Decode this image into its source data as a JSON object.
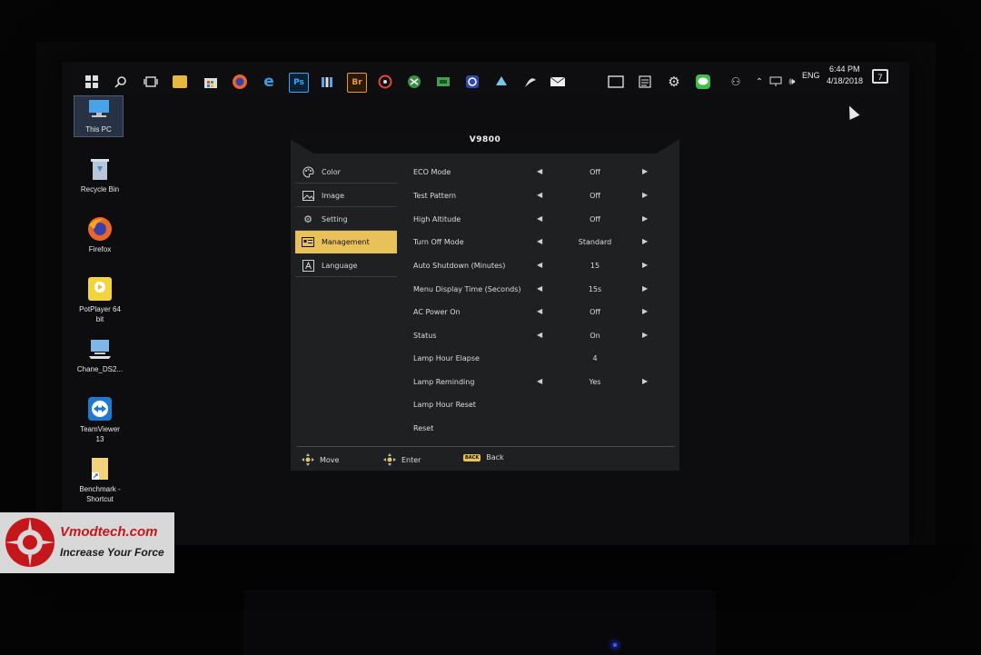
{
  "taskbar": {
    "icons": [
      "windows-start-icon",
      "search-icon",
      "task-view-icon",
      "file-explorer-icon",
      "store-icon",
      "firefox-icon",
      "edge-icon",
      "photoshop-icon",
      "app-icon",
      "bridge-icon",
      "app-icon",
      "app-icon",
      "app-icon",
      "app-icon",
      "app-icon",
      "app-icon",
      "mail-icon",
      "window-icon",
      "app-icon",
      "gear-icon",
      "line-icon"
    ],
    "ps_label": "Ps",
    "br_label": "Br",
    "language": "ENG",
    "time": "6:44 PM",
    "date": "4/18/2018",
    "notifications": "7"
  },
  "desktop": {
    "icons": [
      {
        "label1": "This PC",
        "label2": ""
      },
      {
        "label1": "Recycle Bin",
        "label2": ""
      },
      {
        "label1": "Firefox",
        "label2": ""
      },
      {
        "label1": "PotPlayer 64",
        "label2": "bit"
      },
      {
        "label1": "Chane_DS2...",
        "label2": ""
      },
      {
        "label1": "TeamViewer",
        "label2": "13"
      },
      {
        "label1": "Benchmark -",
        "label2": "Shortcut"
      }
    ]
  },
  "osd": {
    "title": "V9800",
    "menu": [
      {
        "label": "Color",
        "icon": "palette-icon"
      },
      {
        "label": "Image",
        "icon": "image-icon"
      },
      {
        "label": "Setting",
        "icon": "gear-icon"
      },
      {
        "label": "Management",
        "icon": "management-icon",
        "active": true
      },
      {
        "label": "Language",
        "icon": "language-icon"
      }
    ],
    "rows": [
      {
        "label": "ECO Mode",
        "value": "Off"
      },
      {
        "label": "Test Pattern",
        "value": "Off"
      },
      {
        "label": "High Altitude",
        "value": "Off"
      },
      {
        "label": "Turn Off Mode",
        "value": "Standard"
      },
      {
        "label": "Auto Shutdown (Minutes)",
        "value": "15"
      },
      {
        "label": "Menu Display Time (Seconds)",
        "value": "15s"
      },
      {
        "label": "AC Power On",
        "value": "Off"
      },
      {
        "label": "Status",
        "value": "On"
      },
      {
        "label": "Lamp Hour Elapse",
        "value": "4"
      },
      {
        "label": "Lamp Reminding",
        "value": "Yes"
      },
      {
        "label": "Lamp Hour Reset",
        "value": ""
      },
      {
        "label": "Reset",
        "value": ""
      }
    ],
    "arrow_left": "◀",
    "arrow_right": "▶",
    "footer": {
      "move": "Move",
      "enter": "Enter",
      "back_key": "BACK",
      "back": "Back"
    }
  },
  "watermark": {
    "title": "Vmodtech.com",
    "subtitle": "Increase Your Force"
  }
}
